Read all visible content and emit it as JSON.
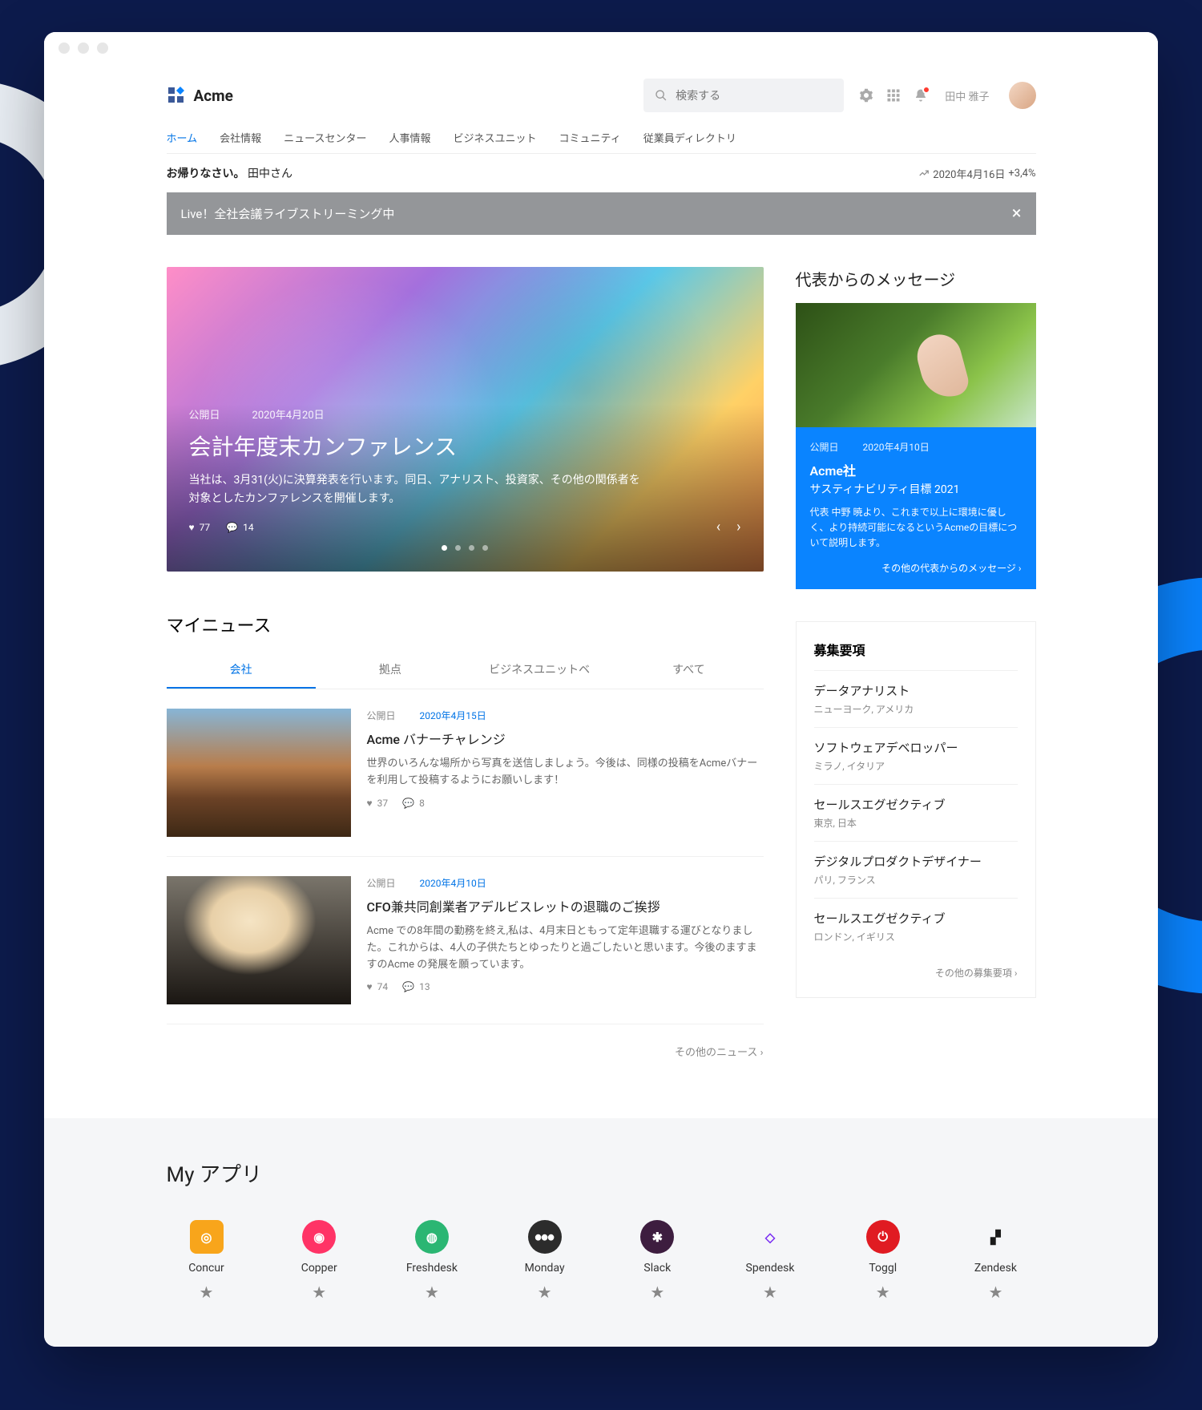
{
  "brand": {
    "name": "Acme"
  },
  "search": {
    "placeholder": "検索する"
  },
  "user": {
    "name": "田中 雅子"
  },
  "nav": {
    "items": [
      "ホーム",
      "会社情報",
      "ニュースセンター",
      "人事情報",
      "ビジネスユニット",
      "コミュニティ",
      "従業員ディレクトリ"
    ]
  },
  "welcome": {
    "greeting": "お帰りなさい。",
    "name": "田中さん"
  },
  "stock": {
    "date": "2020年4月16日",
    "change": "+3,4%"
  },
  "liveBanner": {
    "text": "Live！全社会議ライブストリーミング中"
  },
  "hero": {
    "dateLabel": "公開日",
    "date": "2020年4月20日",
    "title": "会計年度末カンファレンス",
    "description": "当社は、3月31(火)に決算発表を行います。同日、アナリスト、投資家、その他の関係者を対象としたカンファレンスを開催します。",
    "likes": "77",
    "comments": "14"
  },
  "ceoMessage": {
    "heading": "代表からのメッセージ",
    "dateLabel": "公開日",
    "date": "2020年4月10日",
    "company": "Acme社",
    "subtitle": "サスティナビリティ目標 2021",
    "description": "代表 中野 暁より、これまで以上に環境に優しく、より持続可能になるというAcmeの目標について説明します。",
    "moreLink": "その他の代表からのメッセージ"
  },
  "mynews": {
    "heading": "マイニュース",
    "tabs": [
      "会社",
      "拠点",
      "ビジネスユニットベ",
      "すべて"
    ],
    "items": [
      {
        "dateLabel": "公開日",
        "date": "2020年4月15日",
        "title": "Acme バナーチャレンジ",
        "description": "世界のいろんな場所から写真を送信しましょう。今後は、同様の投稿をAcmeバナーを利用して投稿するようにお願いします！",
        "likes": "37",
        "comments": "8"
      },
      {
        "dateLabel": "公開日",
        "date": "2020年4月10日",
        "title": "CFO兼共同創業者アデルビスレットの退職のご挨拶",
        "description": "Acme での8年間の勤務を終え,私は、4月末日ともって定年退職する運びとなりました。これからは、4人の子供たちとゆったりと過ごしたいと思います。今後のますますのAcme の発展を願っています。",
        "likes": "74",
        "comments": "13"
      }
    ],
    "moreLink": "その他のニュース"
  },
  "jobs": {
    "heading": "募集要項",
    "items": [
      {
        "title": "データアナリスト",
        "location": "ニューヨーク, アメリカ"
      },
      {
        "title": "ソフトウェアデベロッパー",
        "location": "ミラノ, イタリア"
      },
      {
        "title": "セールスエグゼクティブ",
        "location": "東京, 日本"
      },
      {
        "title": "デジタルプロダクトデザイナー",
        "location": "パリ, フランス"
      },
      {
        "title": "セールスエグゼクティブ",
        "location": "ロンドン, イギリス"
      }
    ],
    "moreLink": "その他の募集要項"
  },
  "apps": {
    "heading": "My アプリ",
    "items": [
      {
        "name": "Concur",
        "color": "#f8a51b",
        "glyph": "◎",
        "square": true
      },
      {
        "name": "Copper",
        "color": "#ff3366",
        "glyph": "◉"
      },
      {
        "name": "Freshdesk",
        "color": "#2bb673",
        "glyph": "◍"
      },
      {
        "name": "Monday",
        "color": "#2c2c2c",
        "glyph": "⦁⦁⦁"
      },
      {
        "name": "Slack",
        "color": "#3d1d3f",
        "glyph": "✱"
      },
      {
        "name": "Spendesk",
        "color": "#7b2ff2",
        "glyph": "◇",
        "textColor": "#7b2ff2",
        "bg": "transparent"
      },
      {
        "name": "Toggl",
        "color": "#e01b22",
        "glyph": "⏻"
      },
      {
        "name": "Zendesk",
        "color": "#1a1a1a",
        "glyph": "▞",
        "bg": "transparent",
        "textColor": "#1a1a1a"
      }
    ]
  }
}
